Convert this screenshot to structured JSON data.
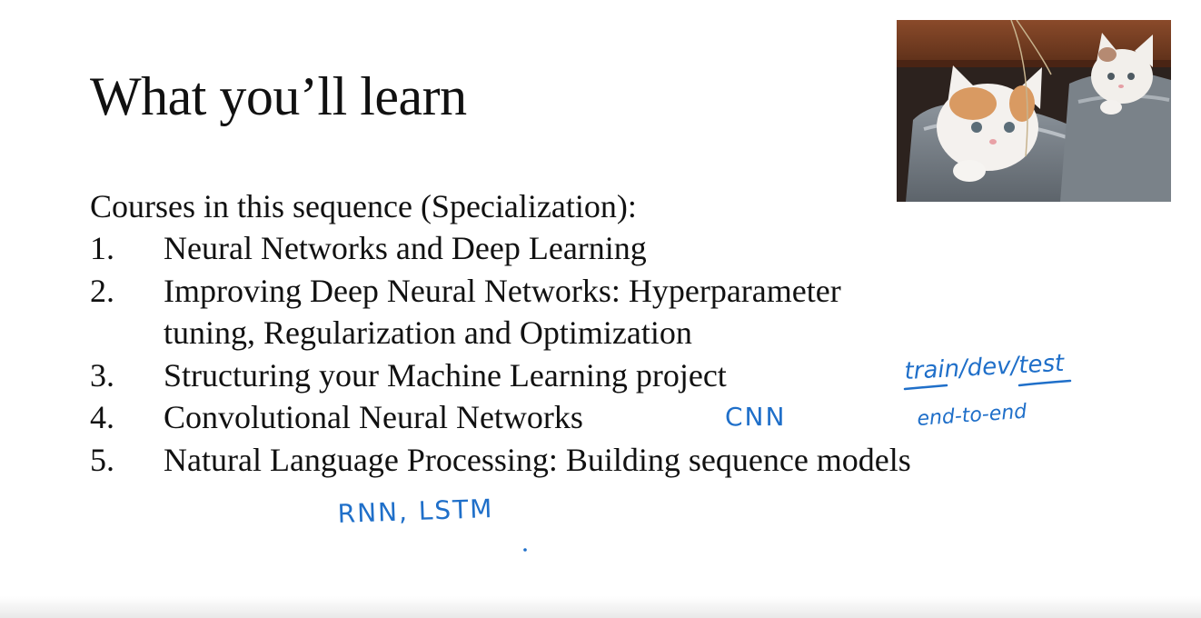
{
  "slide": {
    "title": "What you’ll learn",
    "intro": "Courses in this sequence (Specialization):",
    "courses": [
      {
        "number": "1.",
        "lines": [
          "Neural Networks and Deep Learning"
        ]
      },
      {
        "number": "2.",
        "lines": [
          "Improving Deep Neural Networks: Hyperparameter",
          "tuning, Regularization and Optimization"
        ]
      },
      {
        "number": "3.",
        "lines": [
          "Structuring your Machine Learning project"
        ]
      },
      {
        "number": "4.",
        "lines": [
          "Convolutional Neural Networks"
        ]
      },
      {
        "number": "5.",
        "lines": [
          "Natural Language Processing: Building sequence models"
        ]
      }
    ]
  },
  "annotations": {
    "color": "#1f6fc9",
    "train_dev_test": "train/dev/test",
    "end_to_end": "end-to-end",
    "cnn": "CNN",
    "rnn_lstm": "RNN, LSTM"
  },
  "photo": {
    "subject": "kittens-photo"
  }
}
